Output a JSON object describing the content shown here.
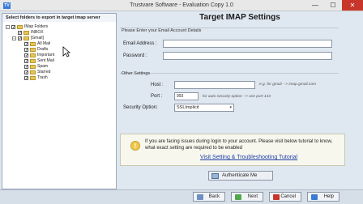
{
  "window": {
    "app_icon": "TV",
    "title": "Trustvare Software - Evaluation Copy 1.0",
    "minimize": "—",
    "maximize": "☐",
    "close": "✕"
  },
  "left_panel": {
    "header": "Select folders to export in target imap server",
    "tree": [
      {
        "label": "IMap Folders",
        "level": 0,
        "expander": "−",
        "checked": true
      },
      {
        "label": "INBOX",
        "level": 1,
        "expander": "",
        "checked": true
      },
      {
        "label": "[Gmail]",
        "level": 1,
        "expander": "−",
        "checked": true
      },
      {
        "label": "All Mail",
        "level": 2,
        "expander": "",
        "checked": true
      },
      {
        "label": "Drafts",
        "level": 2,
        "expander": "",
        "checked": true
      },
      {
        "label": "Important",
        "level": 2,
        "expander": "",
        "checked": true
      },
      {
        "label": "Sent Mail",
        "level": 2,
        "expander": "",
        "checked": true
      },
      {
        "label": "Spam",
        "level": 2,
        "expander": "",
        "checked": true
      },
      {
        "label": "Starred",
        "level": 2,
        "expander": "",
        "checked": true
      },
      {
        "label": "Trash",
        "level": 2,
        "expander": "",
        "checked": true
      }
    ]
  },
  "main": {
    "title": "Target IMAP Settings",
    "account_section": "Please Enter your Email Account Details",
    "email_label": "Email Address :",
    "email_value": "",
    "password_label": "Password :",
    "password_value": "",
    "other_section": "Other Settings",
    "host_label": "Host :",
    "host_value": "",
    "host_hint": "e.g. for gmail --> imap.gmail.com",
    "port_label": "Port :",
    "port_value": "993",
    "port_hint": "for auto security option --> use port 143",
    "security_label": "Security Option:",
    "security_value": "SSLImplicit",
    "info_text": "If you are facing issues during login to your account. Please visit below tutorial to know, what exact setting are required to be enabled",
    "info_link": "Visit Setting & Troubleshooting Tutorial",
    "authenticate_label": "Authenticate Me"
  },
  "footer": {
    "back": "Back",
    "next": "Next",
    "cancel": "Cancel",
    "help": "Help"
  }
}
